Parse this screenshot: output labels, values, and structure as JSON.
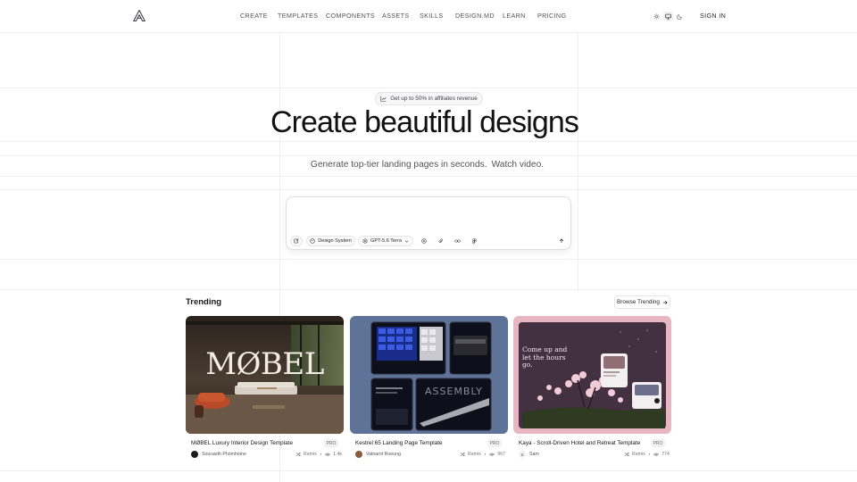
{
  "header": {
    "nav": [
      "CREATE",
      "TEMPLATES",
      "COMPONENTS",
      "ASSETS",
      "SKILLS",
      "DESIGN.MD",
      "LEARN",
      "PRICING"
    ],
    "sign_in": "SIGN IN",
    "theme_modes": [
      "sun-icon",
      "monitor-icon",
      "moon-icon"
    ],
    "active_mode": "monitor-icon"
  },
  "hero": {
    "badge": "Get up to 50% in affiliates revenue",
    "title": "Create beautiful designs",
    "subtitle": "Generate top-tier landing pages in seconds.",
    "video_link": "Watch video."
  },
  "prompt": {
    "design_system": "Design System",
    "model": "GPT-5.6 Terra",
    "placeholder": ""
  },
  "trending": {
    "title": "Trending",
    "browse": "Browse Trending",
    "cards": [
      {
        "title": "MØBEL Luxury Interior Design Template",
        "badge": "PRO",
        "author": "Sourasith Phomhome",
        "remix": "Remix",
        "views": "1.4k",
        "preview_text": "MØBEL"
      },
      {
        "title": "Kestrel 65 Landing Page Template",
        "badge": "PRO",
        "author": "Vatnarot Roeung",
        "remix": "Remix",
        "views": "967",
        "preview_text": "ASSEMBLY"
      },
      {
        "title": "Kaya - Scroll-Driven Hotel and Retreat Template",
        "badge": "PRO",
        "author": "Sam",
        "author_initial": "S",
        "remix": "Remix",
        "views": "774",
        "preview_text": "Come up and let the hours go."
      }
    ]
  },
  "colors": {
    "text": "#18181b",
    "muted": "#52525b",
    "border": "#e5e5e5",
    "grid": "#efefef",
    "kestrel_bg": "#5f7399",
    "kaya_bg": "#e8b6c3"
  }
}
